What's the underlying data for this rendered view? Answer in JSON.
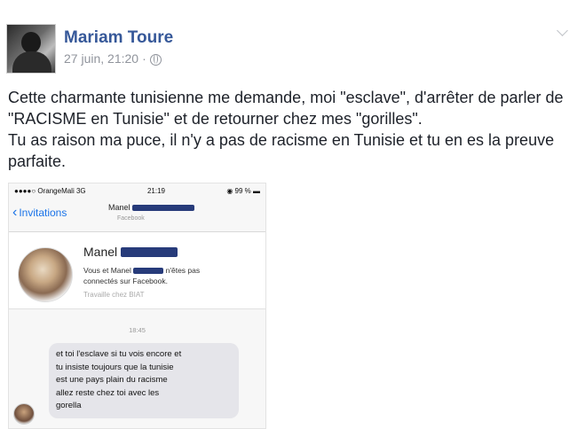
{
  "post": {
    "author": "Mariam Toure",
    "timestamp": "27 juin, 21:20",
    "separator": "·",
    "privacy_icon": "globe-icon",
    "menu_icon": "chevron-down-icon",
    "text_line1": "Cette charmante tunisienne me demande, moi \"esclave\", d'arrêter de parler de \"RACISME en Tunisie\" et de retourner chez mes \"gorilles\".",
    "text_line2": "Tu as raison ma puce, il n'y a pas de racisme en Tunisie et tu en es la preuve parfaite."
  },
  "screenshot": {
    "status_carrier": "●●●●○ OrangeMali  3G",
    "status_time": "21:19",
    "status_battery": "◉ 99 % ▬",
    "back_label": "Invitations",
    "nav_title": "Manel",
    "nav_subtitle": "Facebook",
    "profile_name": "Manel",
    "profile_text_a": "Vous et Manel",
    "profile_text_b": "n'êtes pas connectés sur Facebook.",
    "profile_work": "Travaille chez BIAT",
    "message_time": "18:45",
    "message_text": "et toi l'esclave si tu vois encore et\ntu insiste toujours que la tunisie\nest une pays plain du racisme\nallez reste chez toi avec les\ngorella",
    "censor_color": "#273b7a"
  }
}
